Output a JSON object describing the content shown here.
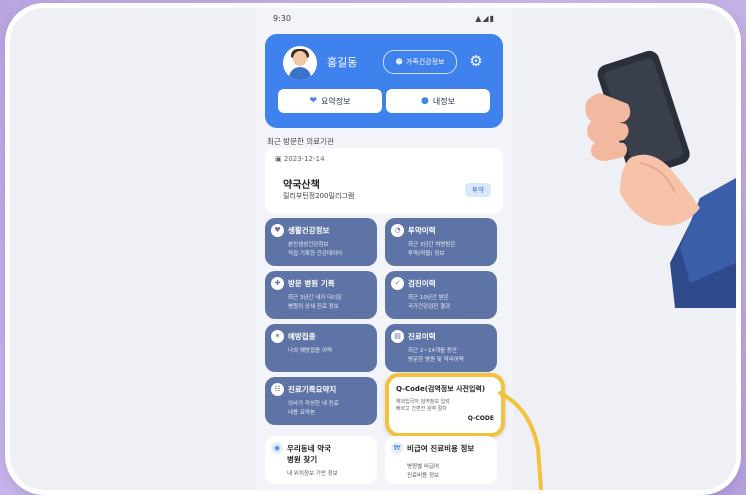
{
  "status_bar": {
    "time": "9:30"
  },
  "header": {
    "user_name": "홍길동",
    "family_button": "가족건강정보",
    "summary_button": "요약정보",
    "my_info_button": "내정보"
  },
  "recent": {
    "section_title": "최근 방문한 의료기관",
    "date": "2023-12-14",
    "name": "약국산책",
    "detail": "릴리부틴정200밀리그램",
    "badge": "투약"
  },
  "tiles": [
    {
      "title": "생활건강정보",
      "line1": "본인생성건강정보",
      "line2": "직접 기록한 건강데이터",
      "icon": "heart-icon"
    },
    {
      "title": "투약이력",
      "line1": "최근 3년간 처방받은",
      "line2": "투약(약물) 정보",
      "icon": "pill-icon"
    },
    {
      "title": "방문 병원 기록",
      "line1": "최근 3년간 내가 다녀온",
      "line2": "병원의 상세 진료 정보",
      "icon": "hospital-icon"
    },
    {
      "title": "검진이력",
      "line1": "최근 10년간 받은",
      "line2": "국가건강검진 결과",
      "icon": "checkup-icon"
    },
    {
      "title": "예방접종",
      "line1": "나의 예방접종 이력",
      "line2": "",
      "icon": "syringe-icon"
    },
    {
      "title": "진료이력",
      "line1": "최근 2~14개월 동안",
      "line2": "방문한 병원 및 약국이력",
      "icon": "clipboard-icon"
    },
    {
      "title": "진료기록요약지",
      "line1": "의사가 작성한 내 진료",
      "line2": "내용 요약본",
      "icon": "document-icon"
    }
  ],
  "qcode": {
    "title": "Q-Code(검역정보 사전입력)",
    "line1": "해외입국자 검역정보 입력",
    "line2": "빠르고 간편한 검역 절차",
    "label": "Q-CODE"
  },
  "bottom_tiles": [
    {
      "title1": "우리동네 약국",
      "title2": "병원 찾기",
      "desc": "내 위치정보 기반 정보",
      "icon": "location-icon"
    },
    {
      "title1": "비급여 진료비용 정보",
      "desc1": "병원별 비급여",
      "desc2": "진료비용 정보",
      "icon": "won-icon"
    }
  ],
  "colors": {
    "primary": "#3f82ee",
    "tile": "#5e74a6",
    "highlight": "#f3c23a",
    "background": "#b9a5e0"
  }
}
